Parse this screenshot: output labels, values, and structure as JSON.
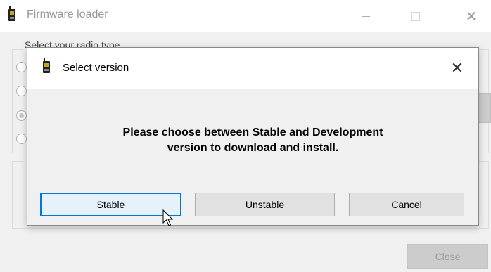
{
  "parent_window": {
    "title": "Firmware loader",
    "icon": "phone-icon",
    "controls": {
      "minimize": "minimize-icon",
      "maximize": "maximize-icon",
      "close": "close-icon"
    },
    "group_label": "Select your radio type",
    "radios": [
      {
        "checked": false
      },
      {
        "checked": false
      },
      {
        "checked": true
      },
      {
        "checked": false
      }
    ],
    "close_button": "Close"
  },
  "dialog": {
    "title": "Select version",
    "icon": "phone-icon",
    "message_line1": "Please choose between Stable and Development",
    "message_line2": "version to download and install.",
    "buttons": {
      "stable": "Stable",
      "unstable": "Unstable",
      "cancel": "Cancel"
    },
    "close_glyph": "✕"
  },
  "colors": {
    "accent": "#0078d7",
    "default_button_bg": "#e5f1fb"
  }
}
